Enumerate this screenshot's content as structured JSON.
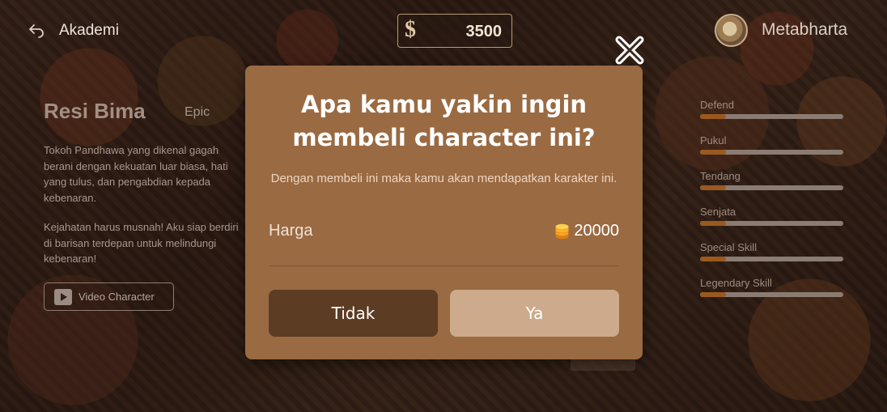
{
  "header": {
    "back_label": "Akademi",
    "currency_symbol": "$",
    "balance": "3500",
    "username": "Metabharta"
  },
  "character": {
    "name": "Resi Bima",
    "rarity": "Epic",
    "description_1": "Tokoh Pandhawa yang dikenal gagah berani dengan kekuatan luar biasa, hati yang tulus, dan pengabdian kepada kebenaran.",
    "description_2": "Kejahatan harus musnah! Aku siap berdiri di barisan terdepan untuk melindungi kebenaran!",
    "video_button_label": "Video Character"
  },
  "stats": [
    {
      "label": "Defend",
      "value": 0.18
    },
    {
      "label": "Pukul",
      "value": 0.18
    },
    {
      "label": "Tendang",
      "value": 0.18
    },
    {
      "label": "Senjata",
      "value": 0.18
    },
    {
      "label": "Special Skill",
      "value": 0.18
    },
    {
      "label": "Legendary Skill",
      "value": 0.18
    }
  ],
  "modal": {
    "title": "Apa kamu yakin ingin membeli character ini?",
    "subtitle": "Dengan membeli ini maka kamu akan mendapatkan karakter ini.",
    "price_label": "Harga",
    "price_value": "20000",
    "cancel_label": "Tidak",
    "confirm_label": "Ya"
  },
  "colors": {
    "modal_bg": "#9a6a42",
    "cancel_bg": "#5c3c22",
    "confirm_bg": "#ccaa8b",
    "stat_fill": "#9a5a1f"
  },
  "icons": {
    "back": "back-arrow-icon",
    "close": "close-icon",
    "coin": "coin-stack-icon",
    "play": "play-icon"
  }
}
